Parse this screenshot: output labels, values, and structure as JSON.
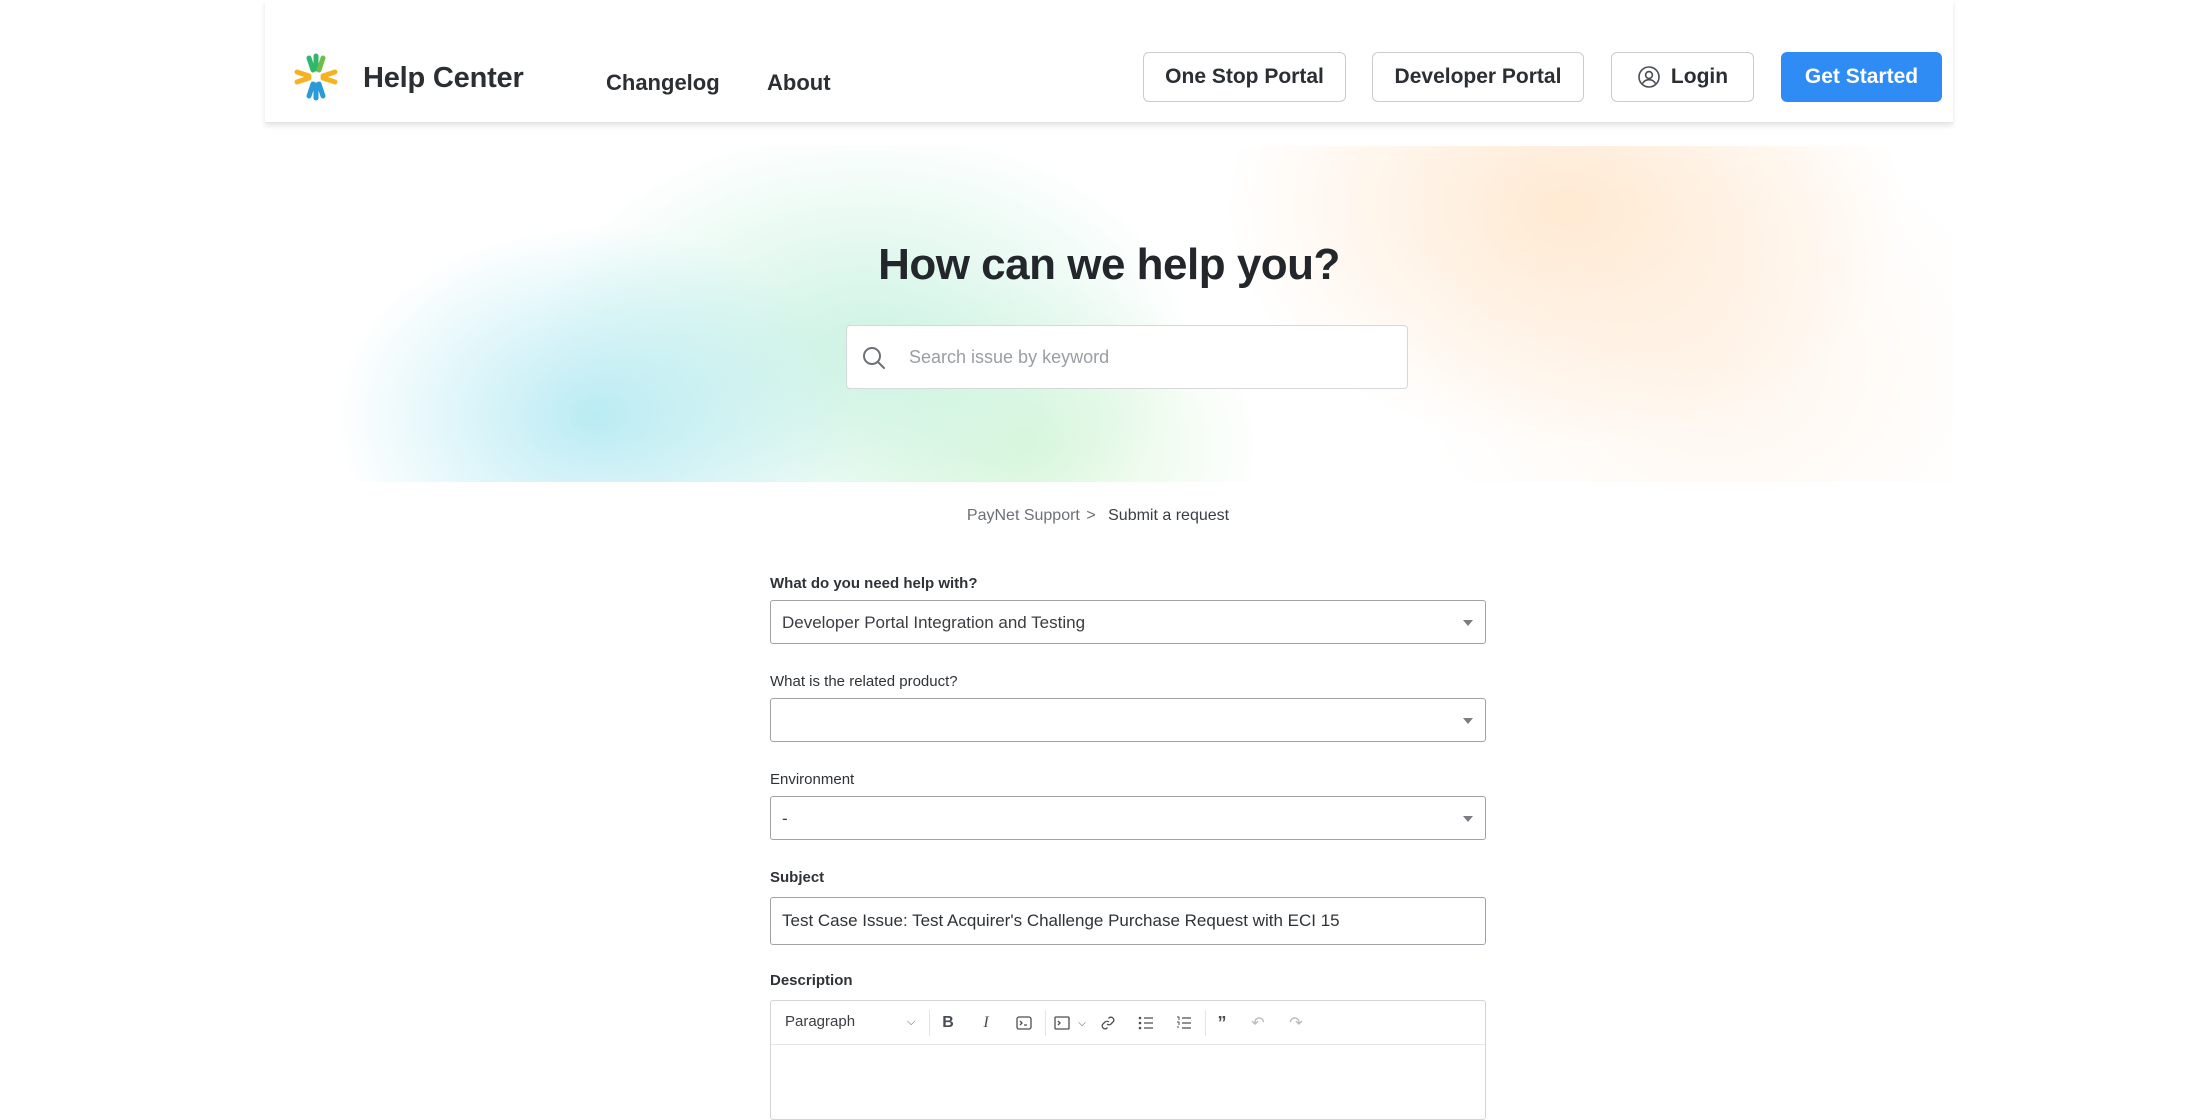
{
  "header": {
    "brand": "Help Center",
    "nav": {
      "changelog": "Changelog",
      "about": "About"
    },
    "buttons": {
      "one_stop_portal": "One Stop Portal",
      "developer_portal": "Developer Portal",
      "login": "Login",
      "get_started": "Get Started"
    },
    "logo_icon": "asterisk-logo-icon",
    "accent_color": "#2f8cf5"
  },
  "hero": {
    "title": "How can we help you?",
    "search_placeholder": "Search issue by keyword"
  },
  "breadcrumb": {
    "parent": "PayNet Support",
    "separator": ">",
    "current": "Submit a request"
  },
  "form": {
    "help_with": {
      "label": "What do you need help with?",
      "value": "Developer Portal Integration and Testing"
    },
    "product": {
      "label": "What is the related product?",
      "value": ""
    },
    "environment": {
      "label": "Environment",
      "value": "-"
    },
    "subject": {
      "label": "Subject",
      "value": "Test Case Issue: Test Acquirer's Challenge Purchase Request with ECI 15"
    },
    "description": {
      "label": "Description",
      "block_format": "Paragraph",
      "tools": [
        "bold-icon",
        "italic-icon",
        "code-icon",
        "code-block-icon",
        "link-icon",
        "bulleted-list-icon",
        "numbered-list-icon",
        "quote-icon",
        "undo-icon",
        "redo-icon"
      ]
    }
  }
}
